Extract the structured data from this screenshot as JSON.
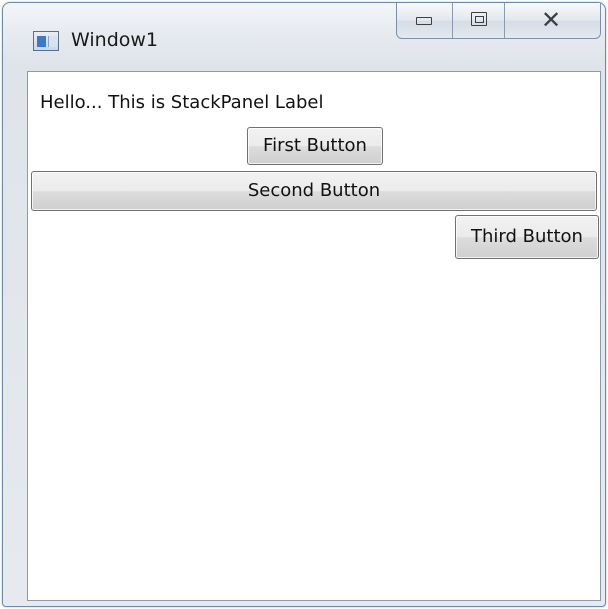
{
  "window": {
    "title": "Window1",
    "icon": "wpf-window-icon"
  },
  "caption_buttons": {
    "minimize_icon": "minimize-icon",
    "maximize_icon": "maximize-icon",
    "close_icon": "close-icon",
    "close_glyph": "☒"
  },
  "stack_panel": {
    "label": "Hello... This is StackPanel Label",
    "buttons": [
      {
        "label": "First Button"
      },
      {
        "label": "Second Button"
      },
      {
        "label": "Third Button"
      }
    ]
  }
}
